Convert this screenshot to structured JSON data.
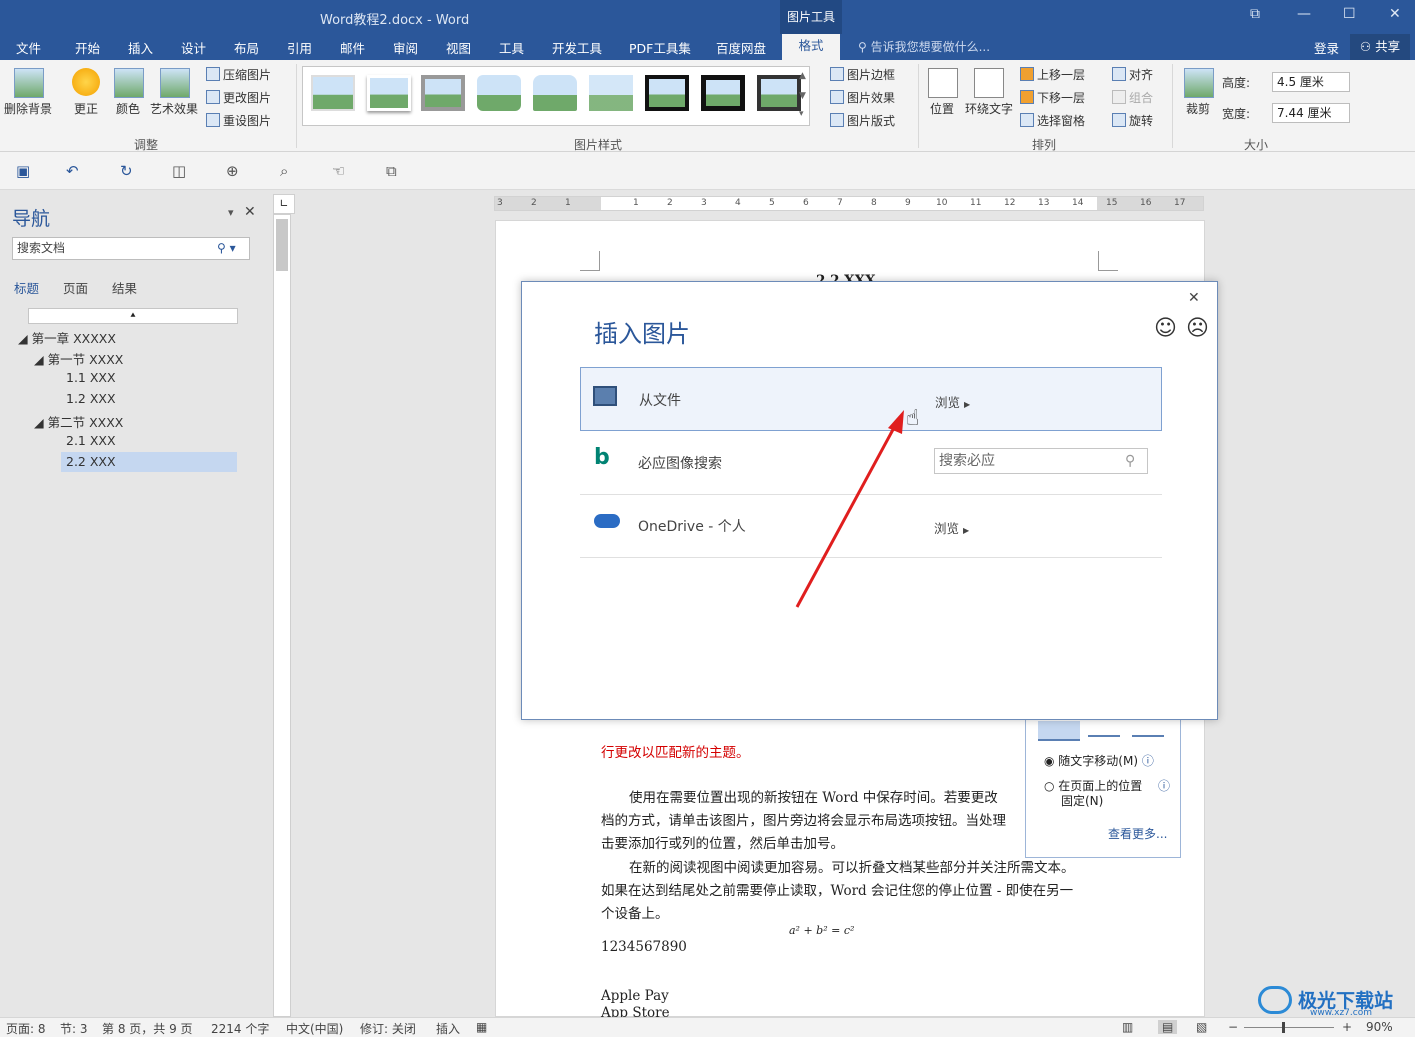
{
  "window": {
    "title": "Word教程2.docx - Word",
    "context_tab": "图片工具",
    "restore": "⧉",
    "minimize": "—",
    "maximize": "☐",
    "close": "✕"
  },
  "menu": {
    "tabs": [
      "文件",
      "开始",
      "插入",
      "设计",
      "布局",
      "引用",
      "邮件",
      "审阅",
      "视图",
      "工具",
      "开发工具",
      "PDF工具集",
      "百度网盘"
    ],
    "active_tab": "格式",
    "tell_me": "告诉我您想要做什么...",
    "login": "登录",
    "share": "共享"
  },
  "ribbon": {
    "adjust": {
      "remove_bg": "删除背景",
      "corrections": "更正",
      "color": "颜色",
      "artistic": "艺术效果",
      "compress": "压缩图片",
      "change": "更改图片",
      "reset": "重设图片",
      "group": "调整"
    },
    "styles": {
      "border": "图片边框",
      "effects": "图片效果",
      "layout": "图片版式",
      "group": "图片样式"
    },
    "arrange": {
      "position": "位置",
      "wrap": "环绕文字",
      "forward": "上移一层",
      "backward": "下移一层",
      "selection": "选择窗格",
      "align": "对齐",
      "group_btn": "组合",
      "rotate": "旋转",
      "group": "排列"
    },
    "size": {
      "crop": "裁剪",
      "height_label": "高度:",
      "height_value": "4.5 厘米",
      "width_label": "宽度:",
      "width_value": "7.44 厘米",
      "group": "大小"
    },
    "brand_color": "#2b579a"
  },
  "nav": {
    "title": "导航",
    "search_placeholder": "搜索文档",
    "tabs": [
      "标题",
      "页面",
      "结果"
    ],
    "tree": [
      {
        "label": "第一章 XXXXX",
        "level": 0
      },
      {
        "label": "第一节 XXXX",
        "level": 1
      },
      {
        "label": "1.1 XXX",
        "level": 2
      },
      {
        "label": "1.2 XXX",
        "level": 2
      },
      {
        "label": "第二节 XXXX",
        "level": 1
      },
      {
        "label": "2.1 XXX",
        "level": 2
      },
      {
        "label": "2.2 XXX",
        "level": 2
      }
    ],
    "selected": "2.2 XXX"
  },
  "ruler": {
    "marks": [
      "3",
      "2",
      "1",
      "",
      "1",
      "2",
      "3",
      "4",
      "5",
      "6",
      "7",
      "8",
      "9",
      "10",
      "11",
      "12",
      "13",
      "14",
      "15",
      "16",
      "17"
    ]
  },
  "document": {
    "heading_partial": "2.2 XXX",
    "red_line": "行更改以匹配新的主题。",
    "p1": "使用在需要位置出现的新按钮在 Word 中保存时间。若要更改",
    "p1b": "档的方式，请单击该图片，图片旁边将会显示布局选项按钮。当处理",
    "p1c": "击要添加行或列的位置，然后单击加号。",
    "p2": "在新的阅读视图中阅读更加容易。可以折叠文档某些部分并关注所需文本。",
    "p2b": "如果在达到结尾处之前需要停止读取，Word 会记住您的停止位置 - 即使在另一",
    "p2c": "个设备上。",
    "formula": "a² + b² = c²",
    "digits": "1234567890",
    "apple_pay": "Apple Pay",
    "app_store": "App Store"
  },
  "layout_popup": {
    "move_with_text": "随文字移动(M)",
    "fix_position": "在页面上的位置",
    "fix_position2": "固定(N)",
    "see_more": "查看更多..."
  },
  "dialog": {
    "title": "插入图片",
    "close": "✕",
    "smile": "☺",
    "frown": "☹",
    "rows": [
      {
        "label": "从文件",
        "action": "浏览"
      },
      {
        "label": "必应图像搜索",
        "placeholder": "搜索必应"
      },
      {
        "label": "OneDrive - 个人",
        "action": "浏览"
      }
    ]
  },
  "status": {
    "page": "页面: 8",
    "section": "节: 3",
    "pages": "第 8 页，共 9 页",
    "words": "2214 个字",
    "lang": "中文(中国)",
    "track": "修订: 关闭",
    "insert": "插入",
    "zoom": "90%"
  },
  "watermark": {
    "text": "极光下载站",
    "url": "www.xz7.com"
  }
}
